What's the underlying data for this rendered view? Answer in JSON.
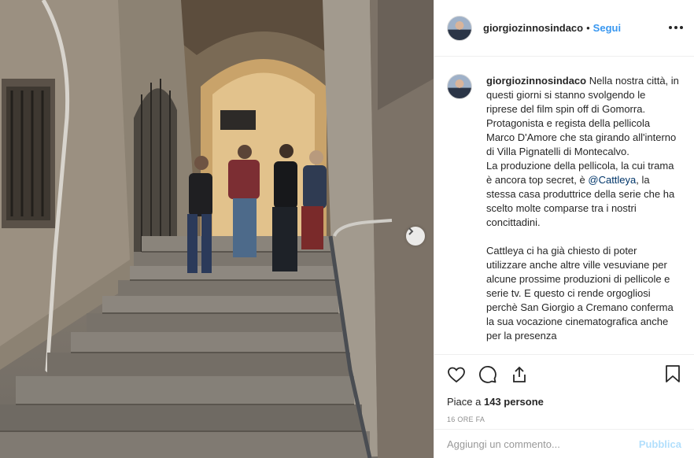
{
  "post": {
    "photo_alt": "Staircase inside Villa Pignatelli",
    "next_icon": "chevron-right-icon"
  },
  "header": {
    "username": "giorgiozinnosindaco",
    "separator": "•",
    "follow_label": "Segui",
    "more_icon": "more-horizontal-icon"
  },
  "caption": {
    "username": "giorgiozinnosindaco",
    "paragraph1": "Nella nostra città, in questi giorni si stanno svolgendo le riprese del film spin off di Gomorra. Protagonista e regista della pellicola Marco D'Amore che sta girando all'interno di Villa Pignatelli di Montecalvo.",
    "paragraph2_start": "La produzione della pellicola, la cui trama è ancora top secret, è",
    "mention": "@Cattleya",
    "paragraph2_end": ", la stessa casa produttrice della serie che ha scelto molte comparse tra i nostri concittadini.",
    "paragraph3": "Cattleya ci ha già chiesto di poter utilizzare anche altre ville vesuviane per alcune prossime produzioni di pellicole e serie tv. E questo ci rende orgogliosi perchè San Giorgio a Cremano conferma la sua vocazione cinematografica anche per la presenza"
  },
  "actions": {
    "like_icon": "heart-icon",
    "comment_icon": "comment-icon",
    "share_icon": "share-icon",
    "save_icon": "bookmark-icon",
    "likes_prefix": "Piace a",
    "likes_count": "143 persone",
    "timestamp": "16 ORE FA"
  },
  "comment": {
    "placeholder": "Aggiungi un commento...",
    "publish_label": "Pubblica"
  },
  "colors": {
    "accent": "#3897f0",
    "publish_disabled": "#b2dffc",
    "mention": "#003569",
    "border": "#efefef"
  }
}
